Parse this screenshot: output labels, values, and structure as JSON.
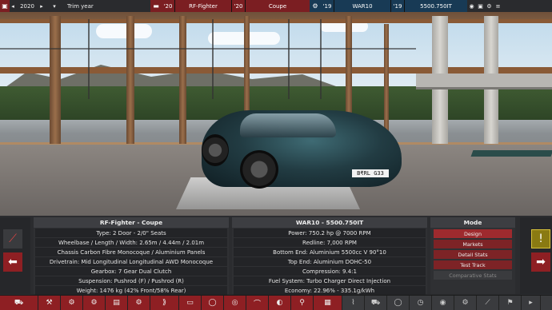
{
  "topbar": {
    "year": "2020",
    "trim_label": "Trim year",
    "trim_year": "'20",
    "model_name": "RF-Fighter",
    "variant_year": "'20",
    "variant_name": "Coupe",
    "engine_family_year": "'19",
    "engine_family": "WAR10",
    "engine_variant_year": "'19",
    "engine_variant": "5500.750IT"
  },
  "viewport": {
    "plate_text": "B₹RL G33"
  },
  "car_panel": {
    "title": "RF-Fighter - Coupe",
    "rows": [
      "Type: 2 Door - 2/0\" Seats",
      "Wheelbase / Length / Width: 2.65m / 4.44m / 2.01m",
      "Chassis Carbon Fibre Monocoque / Aluminium Panels",
      "Drivetrain: Mid Longitudinal Longitudinal AWD Monocoque",
      "Gearbox: 7 Gear Dual Clutch",
      "Suspension: Pushrod (F) / Pushrod (R)",
      "Weight: 1476 kg (42% Front/58% Rear)"
    ]
  },
  "engine_panel": {
    "title": "WAR10 - 5500.750IT",
    "rows": [
      "Power: 750.2 hp @ 7000 RPM",
      "Redline: 7,000 RPM",
      "Bottom End: Aluminium 5500cc V 90°10",
      "Top End: Aluminium DOHC-50",
      "Compression: 9.4:1",
      "Fuel System: Turbo Charger Direct Injection",
      "Economy: 22.96% - 335.1g/kWh"
    ]
  },
  "mode_panel": {
    "title": "Mode",
    "buttons": [
      "Design",
      "Markets",
      "Detail Stats",
      "Test Track",
      "Comparative Stats"
    ]
  },
  "colors": {
    "accent_red": "#8e1f23",
    "topbar_blue": "#183a55",
    "warning_yellow": "#d9c23a"
  }
}
